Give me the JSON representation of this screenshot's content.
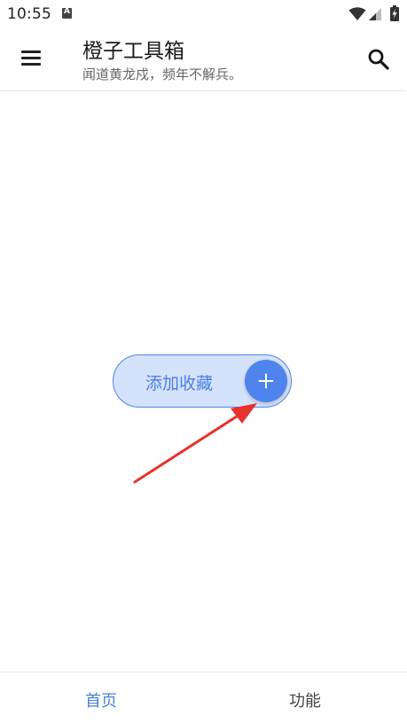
{
  "status_bar": {
    "time": "10:55",
    "notification_icon": "a-badge-icon",
    "notification_letter": "A",
    "icons": [
      "wifi-icon",
      "signal-icon",
      "battery-charging-icon"
    ]
  },
  "app_bar": {
    "menu_icon": "hamburger-menu-icon",
    "title": "橙子工具箱",
    "subtitle": "闻道黄龙戍，频年不解兵。",
    "search_icon": "search-icon"
  },
  "main": {
    "add_favorite_label": "添加收藏",
    "add_icon": "plus-icon",
    "annotation": "red-arrow-pointing-to-add-button"
  },
  "bottom_nav": {
    "items": [
      {
        "label": "首页",
        "active": true
      },
      {
        "label": "功能",
        "active": false
      }
    ]
  },
  "colors": {
    "accent": "#4f84ee",
    "pill_background": "#d5e2fb",
    "active_nav": "#4a7fd8",
    "arrow": "#e8322e"
  }
}
